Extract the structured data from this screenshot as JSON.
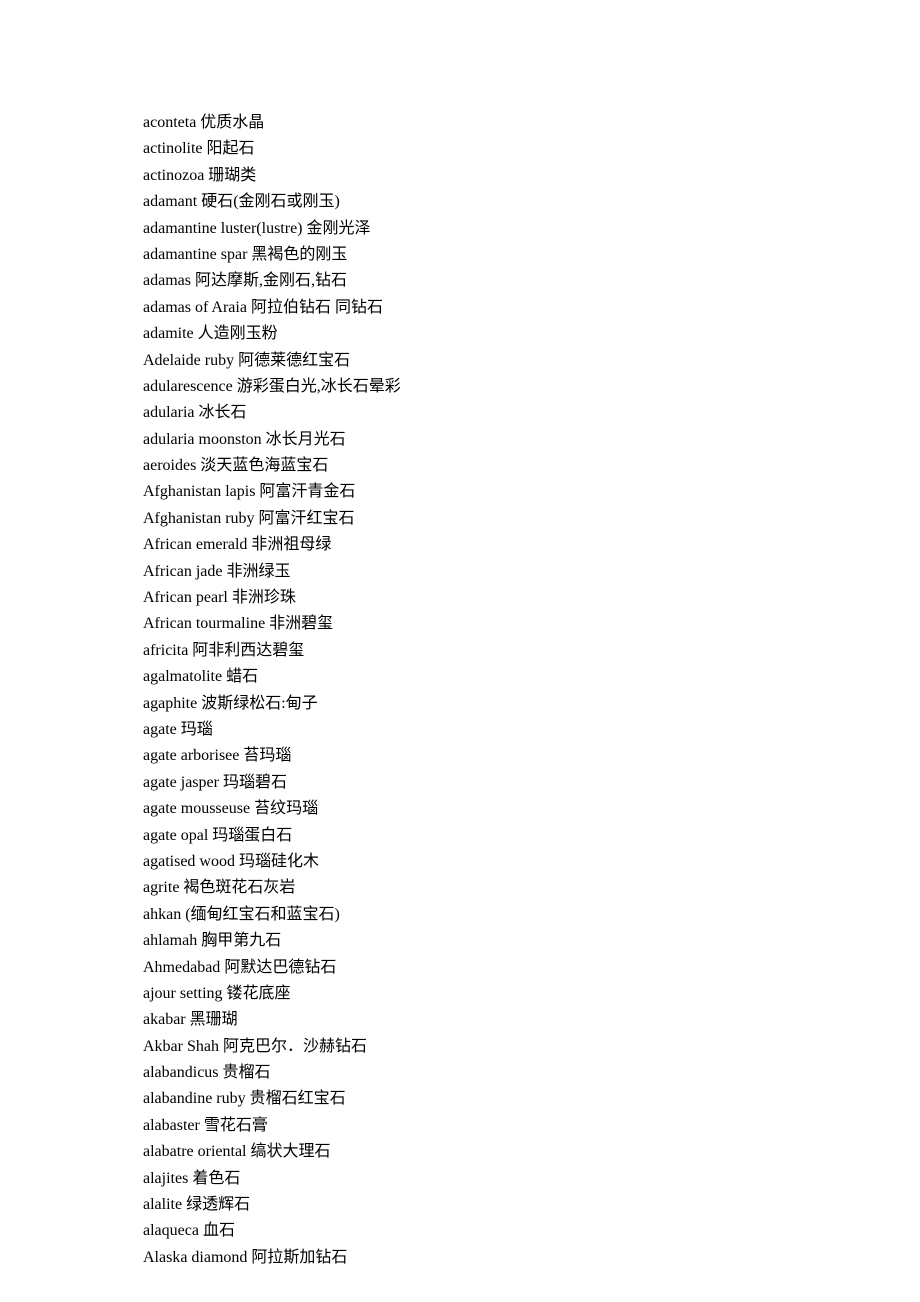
{
  "entries": [
    {
      "term": "aconteta",
      "def": "优质水晶"
    },
    {
      "term": "actinolite",
      "def": "阳起石"
    },
    {
      "term": "actinozoa",
      "def": "珊瑚类"
    },
    {
      "term": "adamant",
      "def": "硬石(金刚石或刚玉)"
    },
    {
      "term": "adamantine luster(lustre)",
      "def": "金刚光泽"
    },
    {
      "term": "adamantine spar",
      "def": "黑褐色的刚玉"
    },
    {
      "term": "adamas",
      "def": "阿达摩斯,金刚石,钻石"
    },
    {
      "term": "adamas of Araia",
      "def": "阿拉伯钻石  同钻石"
    },
    {
      "term": "adamite",
      "def": "人造刚玉粉"
    },
    {
      "term": "Adelaide ruby",
      "def": "阿德莱德红宝石"
    },
    {
      "term": "adularescence",
      "def": "游彩蛋白光,冰长石晕彩"
    },
    {
      "term": "adularia",
      "def": "冰长石"
    },
    {
      "term": "adularia moonston",
      "def": "冰长月光石"
    },
    {
      "term": "aeroides",
      "def": "淡天蓝色海蓝宝石"
    },
    {
      "term": "Afghanistan lapis",
      "def": "阿富汗青金石"
    },
    {
      "term": "Afghanistan ruby",
      "def": "阿富汗红宝石"
    },
    {
      "term": "African emerald",
      "def": "非洲祖母绿"
    },
    {
      "term": "African jade",
      "def": "非洲绿玉"
    },
    {
      "term": "African pearl",
      "def": "非洲珍珠"
    },
    {
      "term": "African tourmaline",
      "def": "非洲碧玺"
    },
    {
      "term": "africita",
      "def": "阿非利西达碧玺"
    },
    {
      "term": "agalmatolite",
      "def": "蜡石"
    },
    {
      "term": "agaphite",
      "def": "波斯绿松石:甸子"
    },
    {
      "term": "agate",
      "def": "玛瑙"
    },
    {
      "term": "agate arborisee",
      "def": "苔玛瑙"
    },
    {
      "term": "agate jasper",
      "def": "玛瑙碧石"
    },
    {
      "term": "agate mousseuse",
      "def": "苔纹玛瑙"
    },
    {
      "term": "agate opal",
      "def": "玛瑙蛋白石"
    },
    {
      "term": "agatised wood",
      "def": "玛瑙硅化木"
    },
    {
      "term": "agrite",
      "def": "褐色斑花石灰岩"
    },
    {
      "term": "ahkan",
      "def": "(缅甸红宝石和蓝宝石)"
    },
    {
      "term": "ahlamah",
      "def": "胸甲第九石"
    },
    {
      "term": "Ahmedabad",
      "def": "阿默达巴德钻石"
    },
    {
      "term": "ajour setting",
      "def": "镂花底座"
    },
    {
      "term": "akabar",
      "def": "黑珊瑚"
    },
    {
      "term": "Akbar Shah",
      "def": "阿克巴尔．沙赫钻石"
    },
    {
      "term": "alabandicus",
      "def": "贵榴石"
    },
    {
      "term": "alabandine ruby",
      "def": "贵榴石红宝石"
    },
    {
      "term": "alabaster",
      "def": "雪花石膏"
    },
    {
      "term": "alabatre oriental",
      "def": "缟状大理石"
    },
    {
      "term": "alajites",
      "def": "着色石"
    },
    {
      "term": "alalite",
      "def": "绿透辉石"
    },
    {
      "term": "alaqueca",
      "def": "血石"
    },
    {
      "term": "Alaska diamond",
      "def": "阿拉斯加钻石"
    }
  ]
}
